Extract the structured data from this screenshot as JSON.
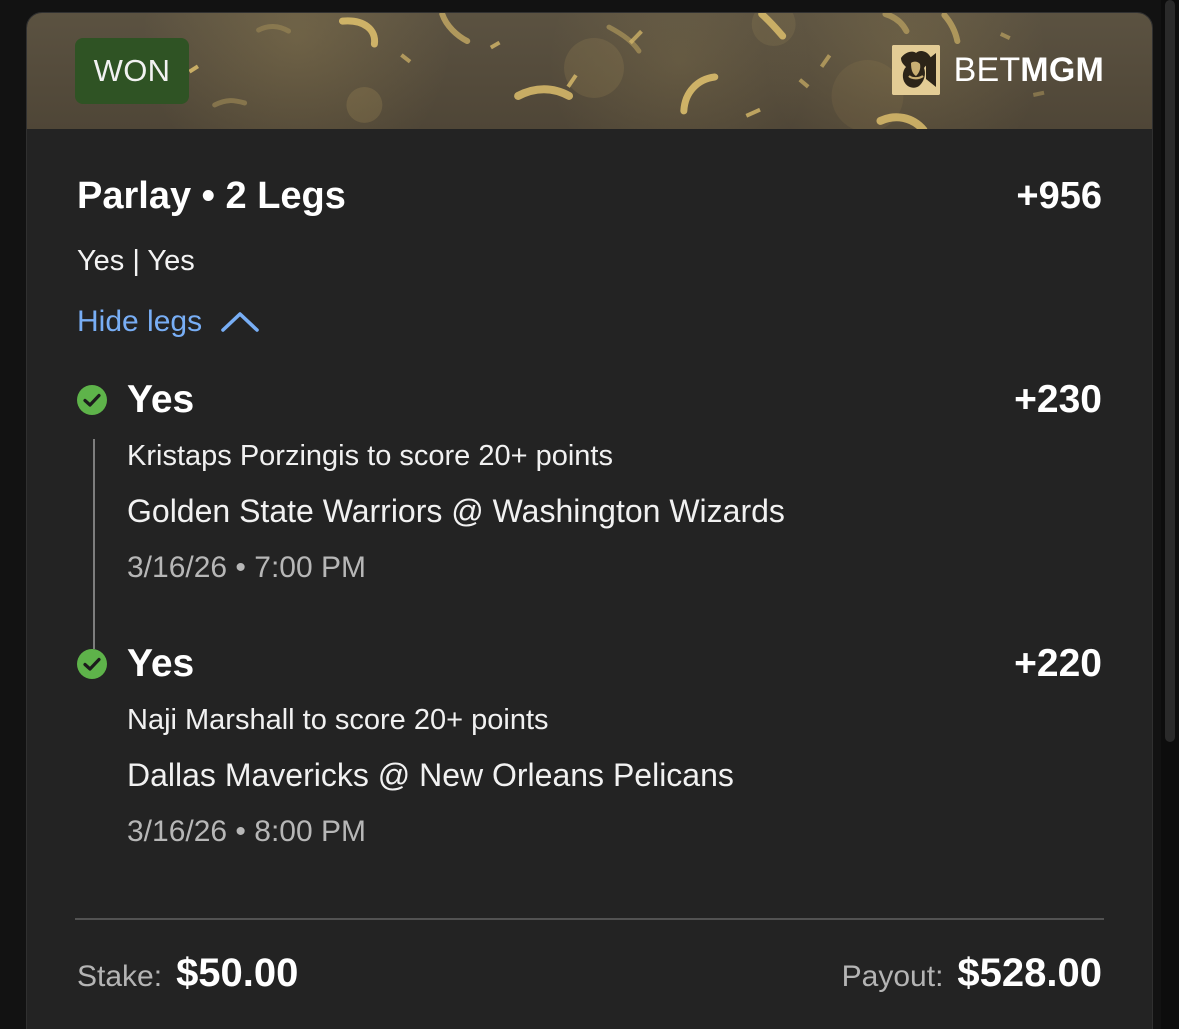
{
  "status": {
    "label": "WON"
  },
  "brand": {
    "logo_icon": "lion-logo-icon",
    "bet": "BET",
    "mgm": "MGM"
  },
  "bet": {
    "title": "Parlay • 2 Legs",
    "odds": "+956",
    "summary": "Yes | Yes",
    "toggle_label": "Hide legs",
    "toggle_icon": "chevron-up-icon"
  },
  "legs": [
    {
      "result": "Yes",
      "odds": "+230",
      "market": "Kristaps Porzingis to score 20+ points",
      "game": "Golden State Warriors @ Washington Wizards",
      "datetime": "3/16/26 • 7:00 PM",
      "status_icon": "check-circle-icon"
    },
    {
      "result": "Yes",
      "odds": "+220",
      "market": "Naji Marshall to score 20+ points",
      "game": "Dallas Mavericks @ New Orleans Pelicans",
      "datetime": "3/16/26 • 8:00 PM",
      "status_icon": "check-circle-icon"
    }
  ],
  "footer": {
    "stake_label": "Stake:",
    "stake_value": "$50.00",
    "payout_label": "Payout:",
    "payout_value": "$528.00"
  },
  "colors": {
    "badge_bg": "#2f5324",
    "link_blue": "#78aef5",
    "success_green": "#5eb34a",
    "gold": "#d4b769"
  }
}
